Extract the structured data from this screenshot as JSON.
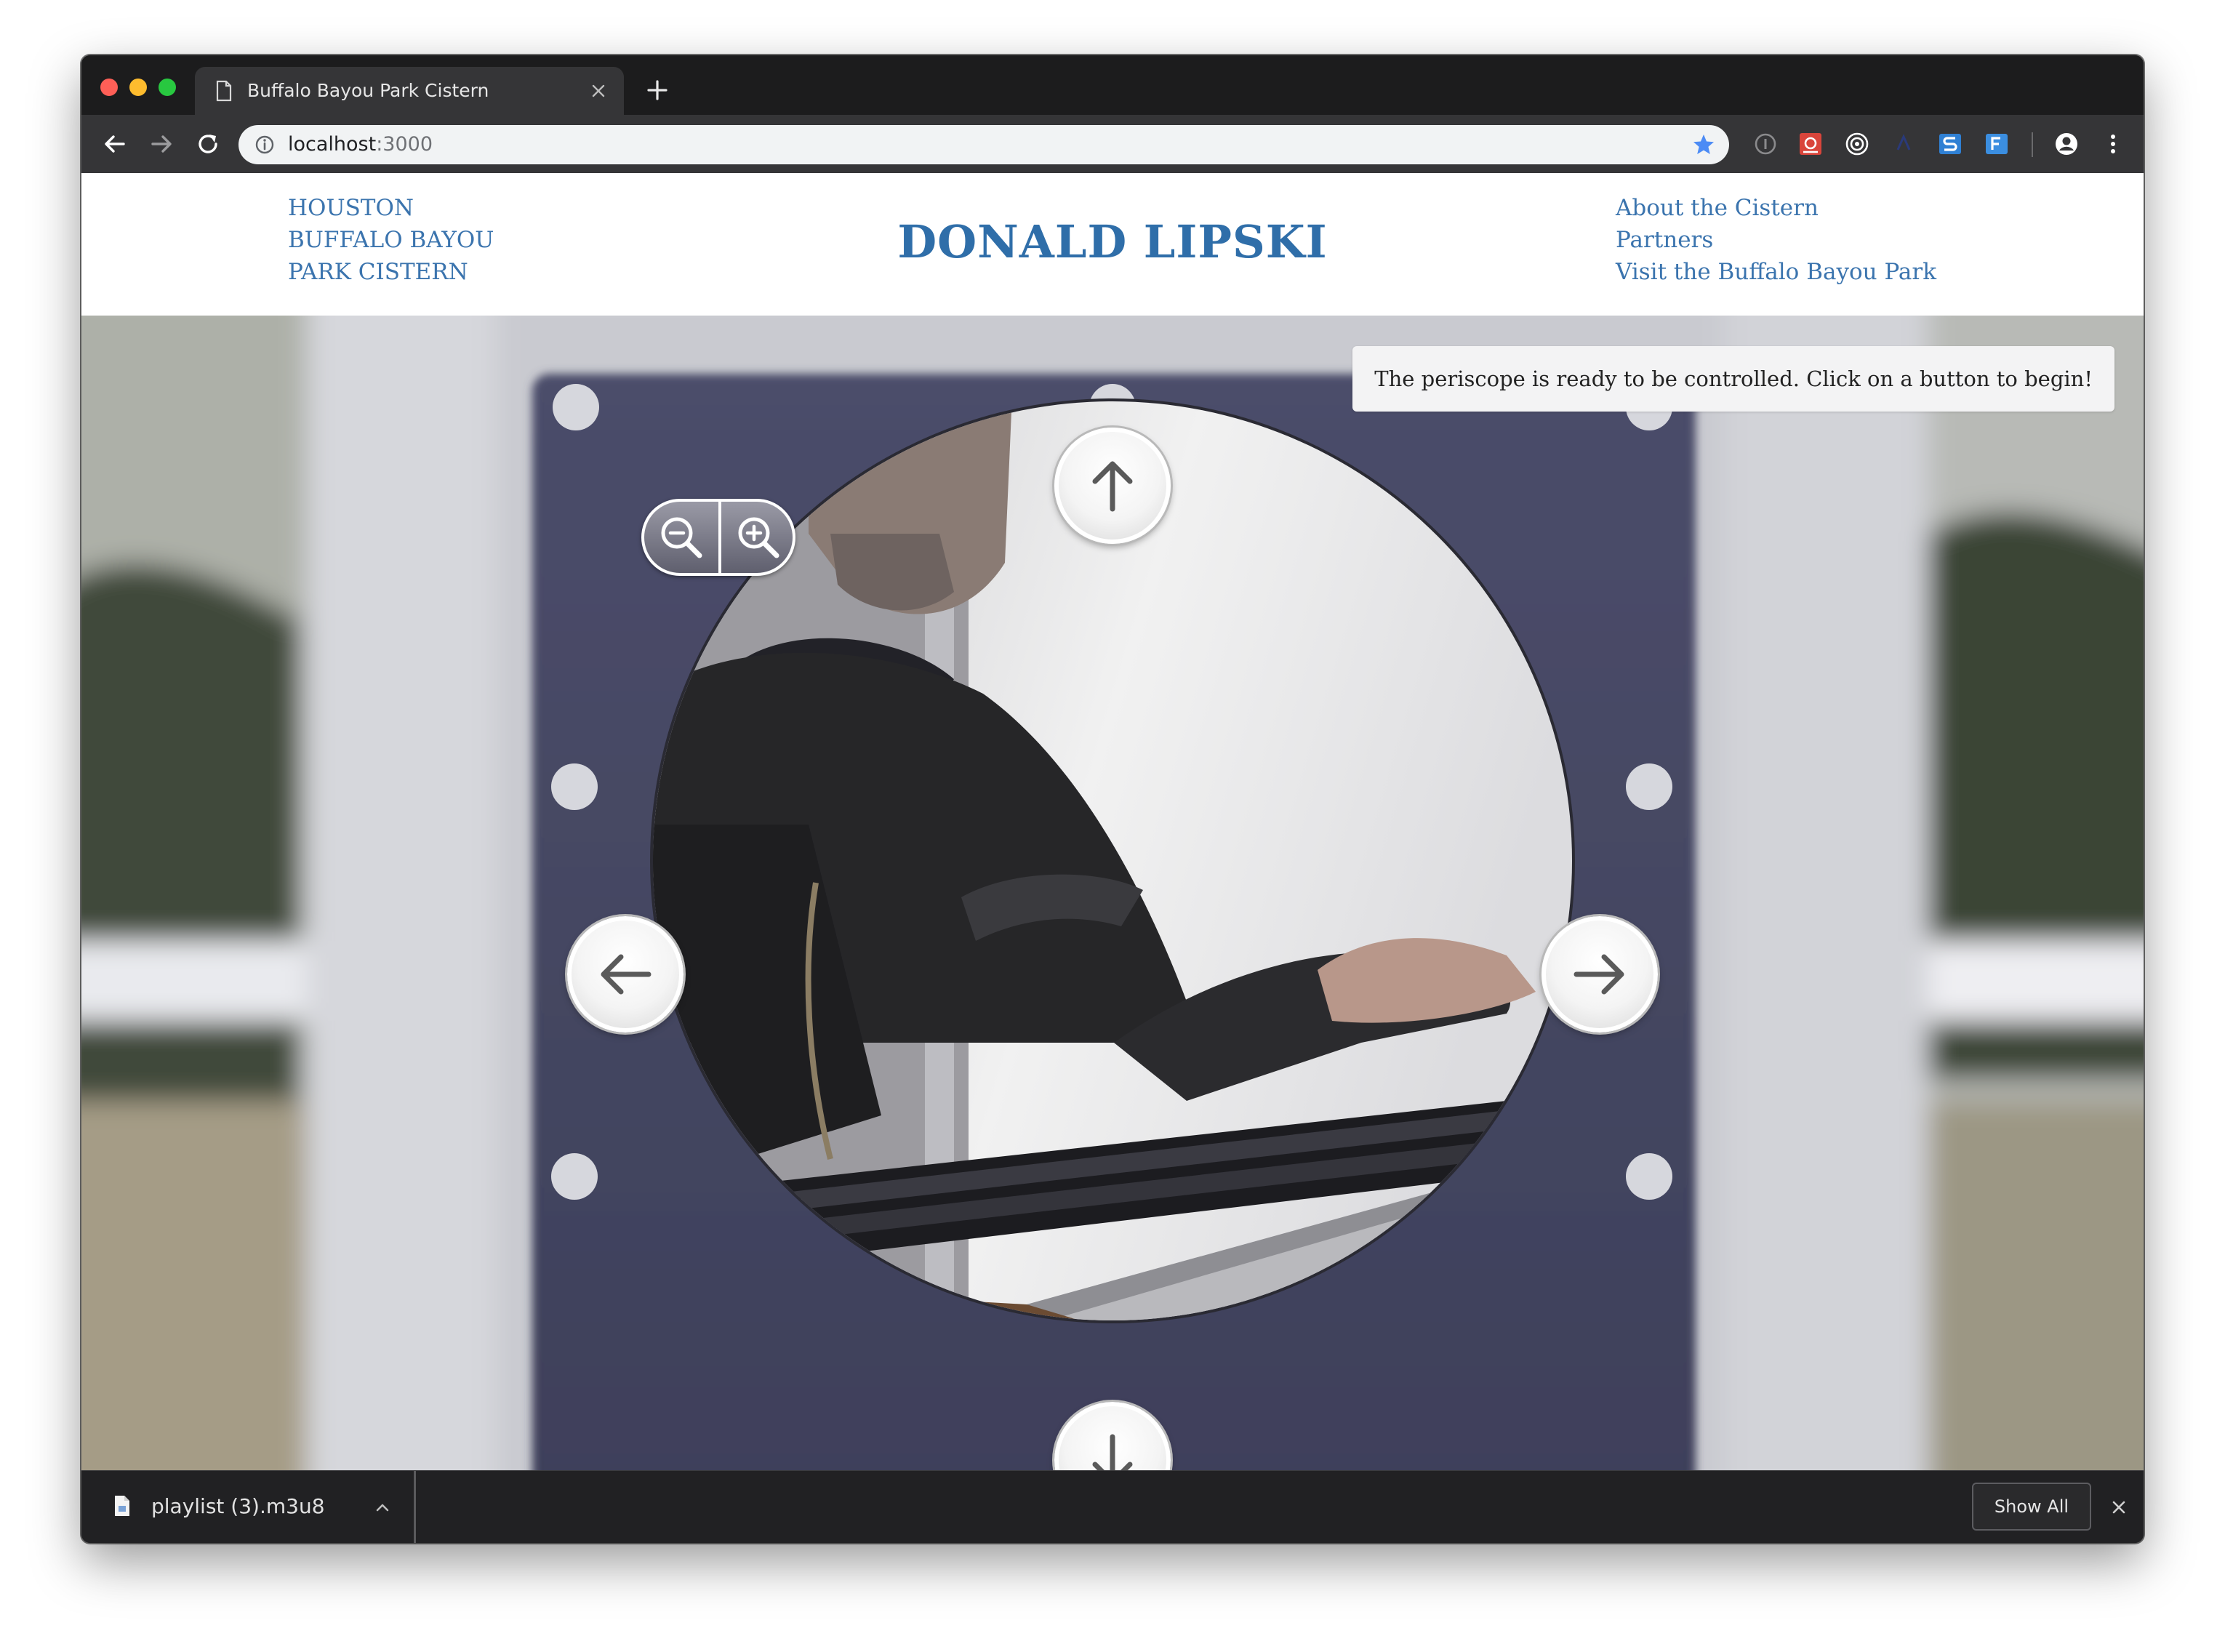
{
  "browser": {
    "tab_title": "Buffalo Bayou Park Cistern",
    "url_host": "localhost",
    "url_port": ":3000"
  },
  "header": {
    "left_links": [
      "HOUSTON",
      "BUFFALO BAYOU",
      "PARK CISTERN"
    ],
    "title": "DONALD LIPSKI",
    "right_links": [
      "About the Cistern",
      "Partners",
      "Visit the Buffalo Bayou Park"
    ]
  },
  "periscope": {
    "status_message": "The periscope is ready to be controlled. Click on a button to begin!"
  },
  "downloads": {
    "file_name": "playlist (3).m3u8",
    "show_all_label": "Show All"
  },
  "colors": {
    "link": "#3b74ae",
    "title": "#2f6ea9",
    "chrome_dark": "#1c1c1d",
    "toolbar": "#353537",
    "star": "#4c8bf5"
  },
  "icons": [
    "document-icon",
    "close-icon",
    "plus-icon",
    "back-arrow-icon",
    "forward-arrow-icon",
    "reload-icon",
    "info-icon",
    "star-icon",
    "profile-icon",
    "menu-dots-icon",
    "arrow-up-icon",
    "arrow-down-icon",
    "arrow-left-icon",
    "arrow-right-icon",
    "zoom-out-icon",
    "zoom-in-icon",
    "file-icon",
    "chevron-up-icon"
  ]
}
